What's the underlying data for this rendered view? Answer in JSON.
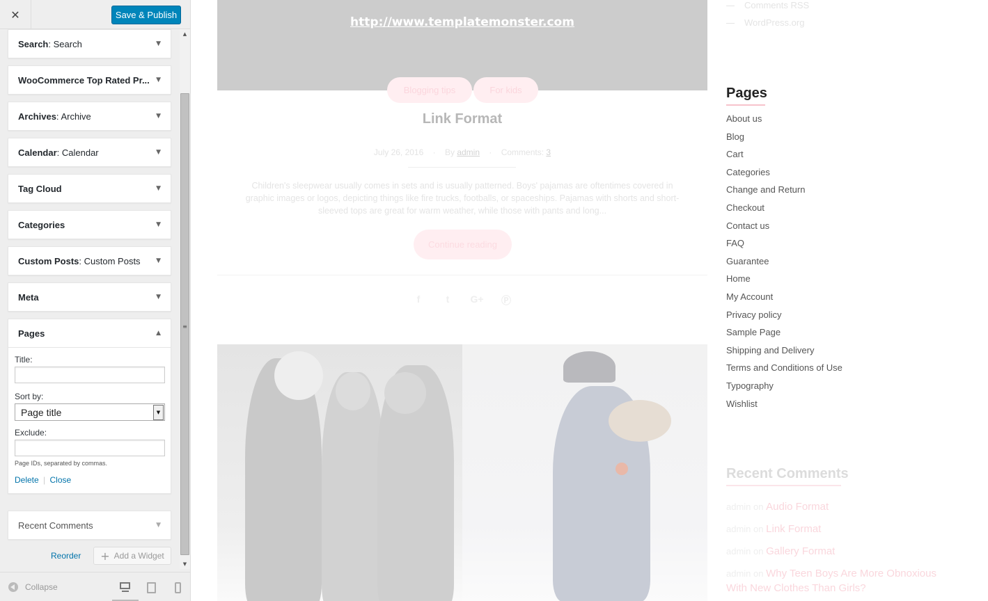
{
  "customizer": {
    "close_icon": "close-icon",
    "publish_label": "Save & Publish",
    "widgets": [
      {
        "type": "Search",
        "title": "Search"
      },
      {
        "type": "WooCommerce Top Rated Pr...",
        "title": ""
      },
      {
        "type": "Archives",
        "title": "Archive"
      },
      {
        "type": "Calendar",
        "title": "Calendar"
      },
      {
        "type": "Tag Cloud",
        "title": ""
      },
      {
        "type": "Categories",
        "title": ""
      },
      {
        "type": "Custom Posts",
        "title": "Custom Posts"
      },
      {
        "type": "Meta",
        "title": ""
      }
    ],
    "pages_widget": {
      "label": "Pages",
      "title_label": "Title:",
      "title_value": "",
      "sortby_label": "Sort by:",
      "sortby_value": "Page title",
      "exclude_label": "Exclude:",
      "exclude_value": "",
      "exclude_hint": "Page IDs, separated by commas.",
      "delete_label": "Delete",
      "separator": "|",
      "close_label": "Close"
    },
    "recent_comments_widget": {
      "label": "Recent Comments"
    },
    "reorder_label": "Reorder",
    "add_widget_label": "Add a Widget",
    "collapse_label": "Collapse",
    "active_device": "desktop"
  },
  "preview": {
    "banner_url": "http://www.templatemonster.com",
    "categories": [
      "Blogging tips",
      "For kids"
    ],
    "post_title": "Link Format",
    "meta": {
      "date": "July 26, 2016",
      "by_label": "By",
      "author": "admin",
      "comments_label": "Comments:",
      "comments_count": "3"
    },
    "excerpt": "Children's sleepwear usually comes in sets and is usually patterned. Boys' pajamas are oftentimes covered in graphic images or logos, depicting things like fire trucks, footballs, or spaceships. Pajamas with shorts and short-sleeved tops are great for warm weather, while those with pants and long...",
    "continue_label": "Continue reading",
    "share_icons": [
      "facebook-icon",
      "twitter-icon",
      "google-plus-icon",
      "pinterest-icon"
    ],
    "share_glyphs": [
      "f",
      "t",
      "G+",
      "Ⓟ"
    ]
  },
  "theme_sidebar": {
    "meta_links": [
      "Comments RSS",
      "WordPress.org"
    ],
    "pages_title": "Pages",
    "pages": [
      "About us",
      "Blog",
      "Cart",
      "Categories",
      "Change and Return",
      "Checkout",
      "Contact us",
      "FAQ",
      "Guarantee",
      "Home",
      "My Account",
      "Privacy policy",
      "Sample Page",
      "Shipping and Delivery",
      "Terms and Conditions of Use",
      "Typography",
      "Wishlist"
    ],
    "recent_comments_title": "Recent Comments",
    "recent_comments": [
      {
        "author": "admin",
        "on": "on",
        "post": "Audio Format"
      },
      {
        "author": "admin",
        "on": "on",
        "post": "Link Format"
      },
      {
        "author": "admin",
        "on": "on",
        "post": "Gallery Format"
      },
      {
        "author": "admin",
        "on": "on",
        "post": "Why Teen Boys Are More Obnoxious With New Clothes Than Girls?"
      }
    ]
  }
}
